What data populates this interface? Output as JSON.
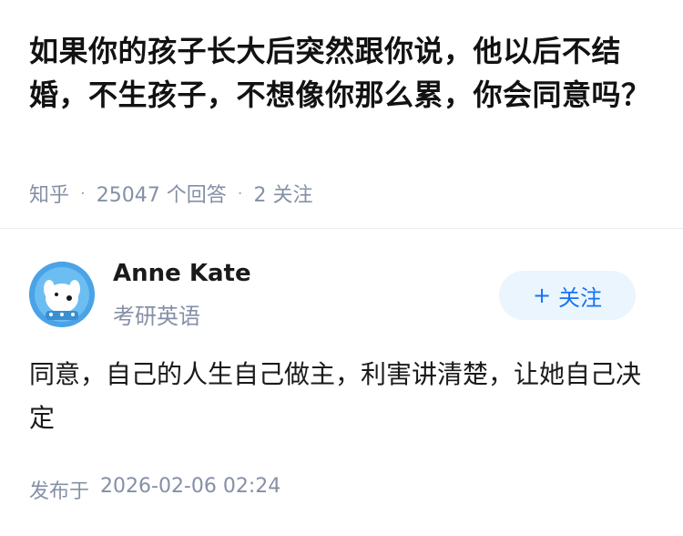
{
  "question": {
    "title": "如果你的孩子长大后突然跟你说，他以后不结婚，不生孩子，不想像你那么累，你会同意吗？",
    "source": "知乎",
    "answer_count": "25047",
    "answer_label": "个回答",
    "follow_count": "2",
    "follow_label": "关注",
    "separator": "·"
  },
  "answer": {
    "author_name": "Anne Kate",
    "author_bio": "考研英语",
    "follow_plus": "+",
    "follow_label": "关注",
    "content": "同意，自己的人生自己做主，利害讲清楚，让她自己决定",
    "published_label": "发布于",
    "published_time": "2026-02-06 02:24"
  },
  "colors": {
    "accent": "#1772f6",
    "follow_bg": "#ebf5fd",
    "meta_gray": "#8590a6",
    "avatar_bg": "#4aa3e6"
  },
  "icons": {
    "avatar": "cartoon-dog-avatar-icon"
  }
}
